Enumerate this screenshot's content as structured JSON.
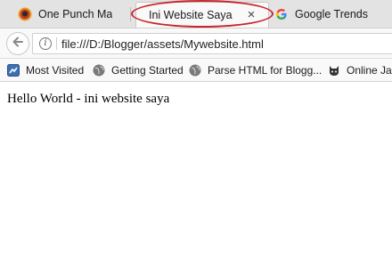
{
  "tabs": [
    {
      "title": "One Punch Ma",
      "active": false,
      "favicon": "one-punch-man-favicon"
    },
    {
      "title": "Ini Website Saya",
      "active": true,
      "close": "×"
    },
    {
      "title": "Google Trends",
      "active": false,
      "favicon": "google-g-icon"
    }
  ],
  "highlight_color": "#c8262c",
  "navbar": {
    "url": "file:///D:/Blogger/assets/Mywebsite.html",
    "info_glyph": "i"
  },
  "bookmarks": [
    {
      "label": "Most Visited",
      "icon": "most-visited-icon"
    },
    {
      "label": "Getting Started",
      "icon": "globe-icon"
    },
    {
      "label": "Parse HTML for Blogg...",
      "icon": "globe-icon"
    },
    {
      "label": "Online Jav",
      "icon": "cat-icon"
    }
  ],
  "page": {
    "text": "Hello World - ini website saya"
  }
}
